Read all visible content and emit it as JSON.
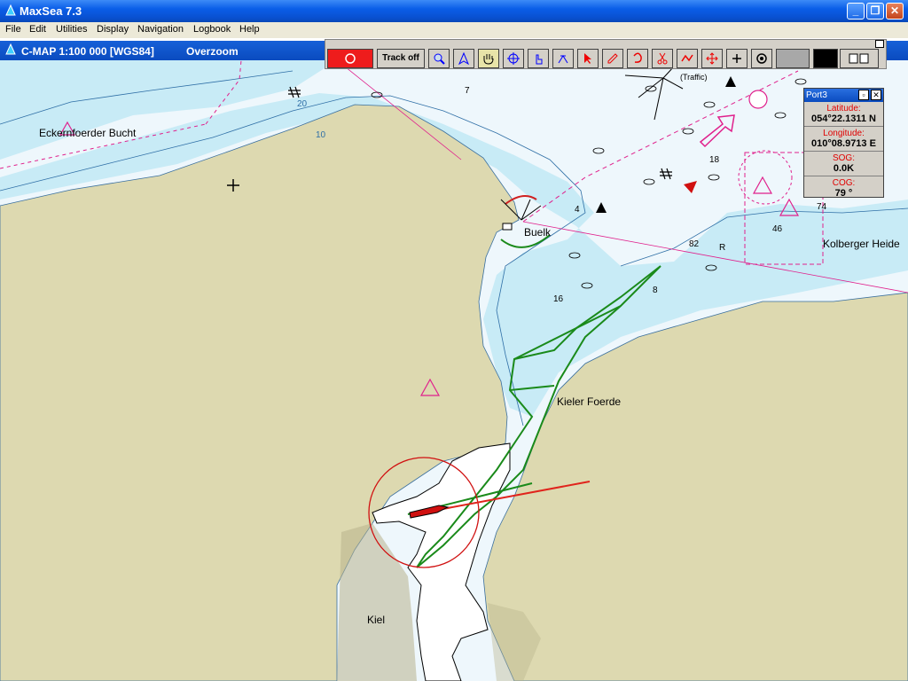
{
  "window": {
    "title": "MaxSea 7.3"
  },
  "menu": [
    "File",
    "Edit",
    "Utilities",
    "Display",
    "Navigation",
    "Logbook",
    "Help"
  ],
  "chart": {
    "title": "C-MAP  1:100 000 [WGS84]",
    "mode": "Overzoom"
  },
  "toolbar": {
    "track_label": "Track off"
  },
  "port": {
    "title": "Port3",
    "latitude_label": "Latitude:",
    "latitude": "054°22.1311 N",
    "longitude_label": "Longitude:",
    "longitude": "010°08.9713 E",
    "sog_label": "SOG:",
    "sog": "0.0K",
    "cog_label": "COG:",
    "cog": "79 °"
  },
  "places": {
    "eckernfoerder": "Eckernfoerder Bucht",
    "buelk": "Buelk",
    "kolberger": "Kolberger Heide",
    "kieler": "Kieler Foerde",
    "kiel": "Kiel",
    "traffic": "(Traffic)"
  },
  "depths": [
    "20",
    "10",
    "7",
    "4",
    "16",
    "18",
    "8",
    "74",
    "46",
    "82",
    "R"
  ],
  "colors": {
    "land": "#ddd9b0",
    "shallow": "#c6ecf7",
    "deep": "#eaf6fb",
    "track": "#1a8a1a",
    "heading": "#e0241c"
  }
}
